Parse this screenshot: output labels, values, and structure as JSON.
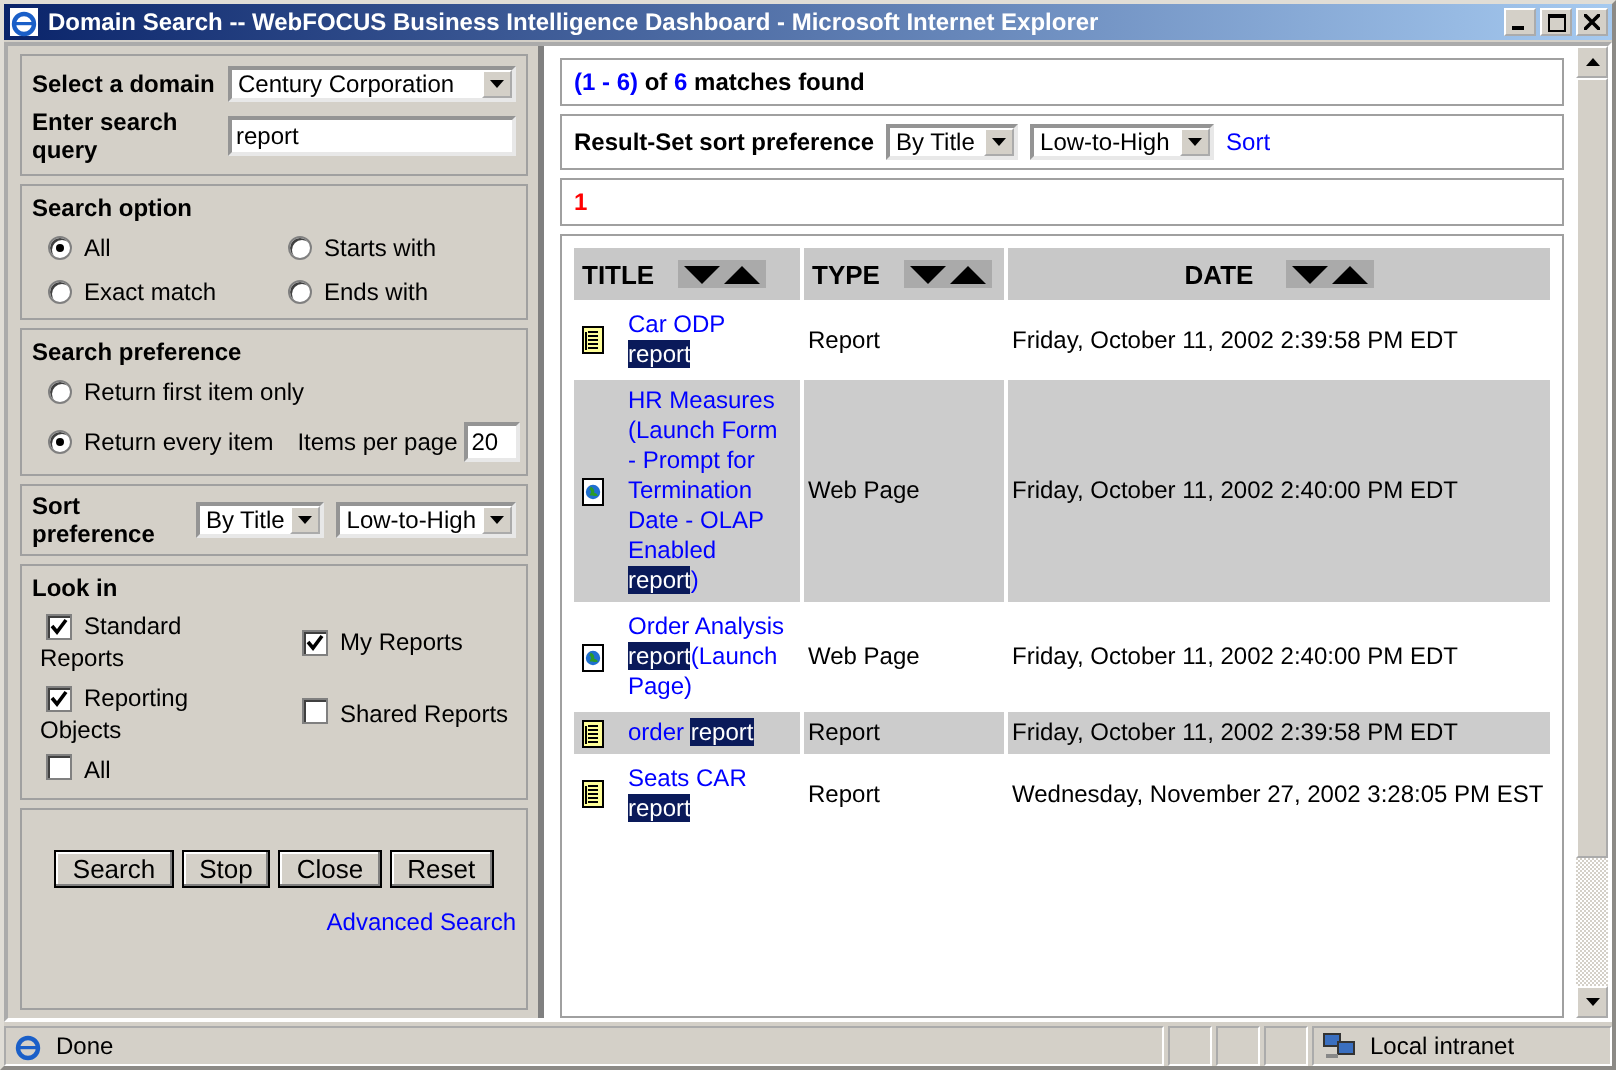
{
  "window": {
    "title": "Domain Search -- WebFOCUS Business Intelligence Dashboard - Microsoft Internet Explorer"
  },
  "search_form": {
    "domain": {
      "label": "Select a domain",
      "value": "Century Corporation"
    },
    "query": {
      "label": "Enter search query",
      "value": "report"
    }
  },
  "search_option": {
    "heading": "Search option",
    "options": [
      {
        "label": "All",
        "selected": true
      },
      {
        "label": "Starts with",
        "selected": false
      },
      {
        "label": "Exact match",
        "selected": false
      },
      {
        "label": "Ends with",
        "selected": false
      }
    ]
  },
  "search_preference": {
    "heading": "Search preference",
    "options": [
      {
        "label": "Return first item only",
        "selected": false
      },
      {
        "label": "Return every item",
        "selected": true
      }
    ],
    "items_per_page": {
      "label": "Items per page",
      "value": "20"
    }
  },
  "sort_preference": {
    "label": "Sort preference",
    "field": "By Title",
    "order": "Low-to-High"
  },
  "look_in": {
    "heading": "Look in",
    "items": [
      {
        "label": "Standard Reports",
        "checked": true
      },
      {
        "label": "My Reports",
        "checked": true
      },
      {
        "label": "Reporting Objects",
        "checked": true
      },
      {
        "label": "Shared Reports",
        "checked": false
      },
      {
        "label": "All",
        "checked": false
      }
    ]
  },
  "buttons": [
    "Search",
    "Stop",
    "Close",
    "Reset"
  ],
  "advanced_link": "Advanced Search",
  "results": {
    "range": "(1 - 6)",
    "of": "of",
    "total": "6",
    "suffix": "matches found"
  },
  "result_sort": {
    "label": "Result-Set sort preference",
    "field": "By Title",
    "order": "Low-to-High",
    "action": "Sort"
  },
  "pages": [
    "1"
  ],
  "table": {
    "columns": [
      "TITLE",
      "TYPE",
      "DATE"
    ],
    "rows": [
      {
        "kind": "report",
        "title": {
          "before": "Car ODP",
          "match": "report"
        },
        "type": "Report",
        "date": "Friday, October 11, 2002 2:39:58 PM EDT"
      },
      {
        "kind": "web",
        "title": {
          "before": "HR Measures (Launch Form - Prompt for Termination Date - OLAP Enabled",
          "match": "report",
          "after": ")"
        },
        "type": "Web Page",
        "date": "Friday, October 11, 2002 2:40:00 PM EDT"
      },
      {
        "kind": "web",
        "title": {
          "before": "Order Analysis",
          "match": "report",
          "after": "(Launch Page)"
        },
        "type": "Web Page",
        "date": "Friday, October 11, 2002 2:40:00 PM EDT"
      },
      {
        "kind": "report",
        "title": {
          "before": "order",
          "match": "report"
        },
        "type": "Report",
        "date": "Friday, October 11, 2002 2:39:58 PM EDT"
      },
      {
        "kind": "report",
        "title": {
          "before": "Seats CAR",
          "match": "report"
        },
        "type": "Report",
        "date": "Wednesday, November 27, 2002 3:28:05 PM EST"
      }
    ]
  },
  "status_bar": {
    "text": "Done",
    "zone": "Local intranet"
  }
}
